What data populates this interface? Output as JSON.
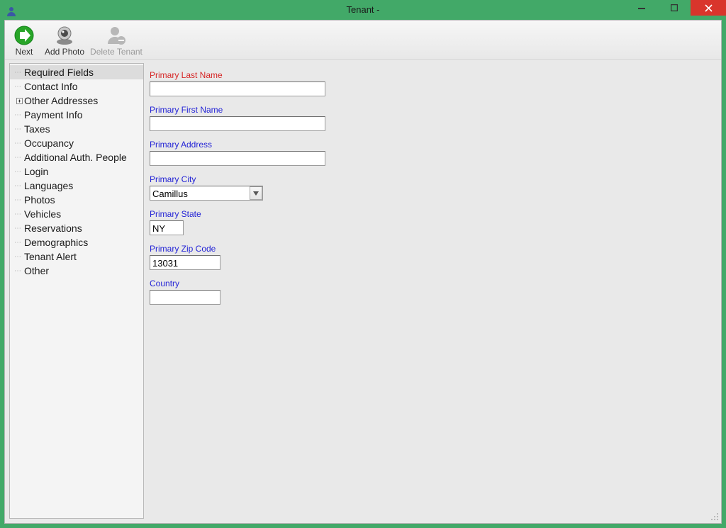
{
  "window": {
    "title": "Tenant -"
  },
  "toolbar": {
    "next": "Next",
    "add_photo": "Add Photo",
    "delete_tenant": "Delete Tenant"
  },
  "tree": {
    "items": [
      {
        "label": "Required Fields",
        "expandable": false,
        "selected": true
      },
      {
        "label": "Contact Info",
        "expandable": false,
        "selected": false
      },
      {
        "label": "Other Addresses",
        "expandable": true,
        "selected": false
      },
      {
        "label": "Payment Info",
        "expandable": false,
        "selected": false
      },
      {
        "label": "Taxes",
        "expandable": false,
        "selected": false
      },
      {
        "label": "Occupancy",
        "expandable": false,
        "selected": false
      },
      {
        "label": "Additional Auth. People",
        "expandable": false,
        "selected": false
      },
      {
        "label": "Login",
        "expandable": false,
        "selected": false
      },
      {
        "label": "Languages",
        "expandable": false,
        "selected": false
      },
      {
        "label": "Photos",
        "expandable": false,
        "selected": false
      },
      {
        "label": "Vehicles",
        "expandable": false,
        "selected": false
      },
      {
        "label": "Reservations",
        "expandable": false,
        "selected": false
      },
      {
        "label": "Demographics",
        "expandable": false,
        "selected": false
      },
      {
        "label": "Tenant Alert",
        "expandable": false,
        "selected": false
      },
      {
        "label": "Other",
        "expandable": false,
        "selected": false
      }
    ]
  },
  "form": {
    "last_name": {
      "label": "Primary Last Name",
      "value": ""
    },
    "first_name": {
      "label": "Primary First Name",
      "value": ""
    },
    "address": {
      "label": "Primary Address",
      "value": ""
    },
    "city": {
      "label": "Primary City",
      "value": "Camillus"
    },
    "state": {
      "label": "Primary State",
      "value": "NY"
    },
    "zip": {
      "label": "Primary Zip Code",
      "value": "13031"
    },
    "country": {
      "label": "Country",
      "value": ""
    }
  }
}
